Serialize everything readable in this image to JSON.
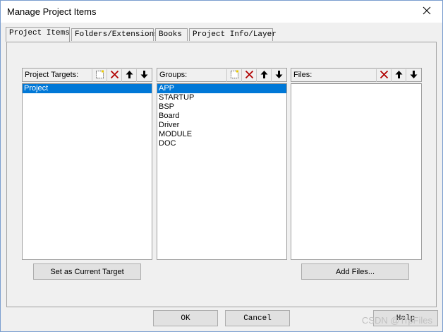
{
  "window": {
    "title": "Manage Project Items"
  },
  "tabs": [
    {
      "label": "Project Items"
    },
    {
      "label": "Folders/Extensions"
    },
    {
      "label": "Books"
    },
    {
      "label": "Project Info/Layer"
    }
  ],
  "targets": {
    "label": "Project Targets:",
    "items": [
      "Project"
    ],
    "selected_index": 0,
    "set_current_button": "Set as Current Target"
  },
  "groups": {
    "label": "Groups:",
    "items": [
      "APP",
      "STARTUP",
      "BSP",
      "Board",
      "Driver",
      "MODULE",
      "DOC"
    ],
    "selected_index": 0
  },
  "files": {
    "label": "Files:",
    "items": [],
    "add_button": "Add Files..."
  },
  "footer": {
    "ok": "OK",
    "cancel": "Cancel",
    "help": "Help"
  },
  "watermark": "CSDN @TrpFiles"
}
